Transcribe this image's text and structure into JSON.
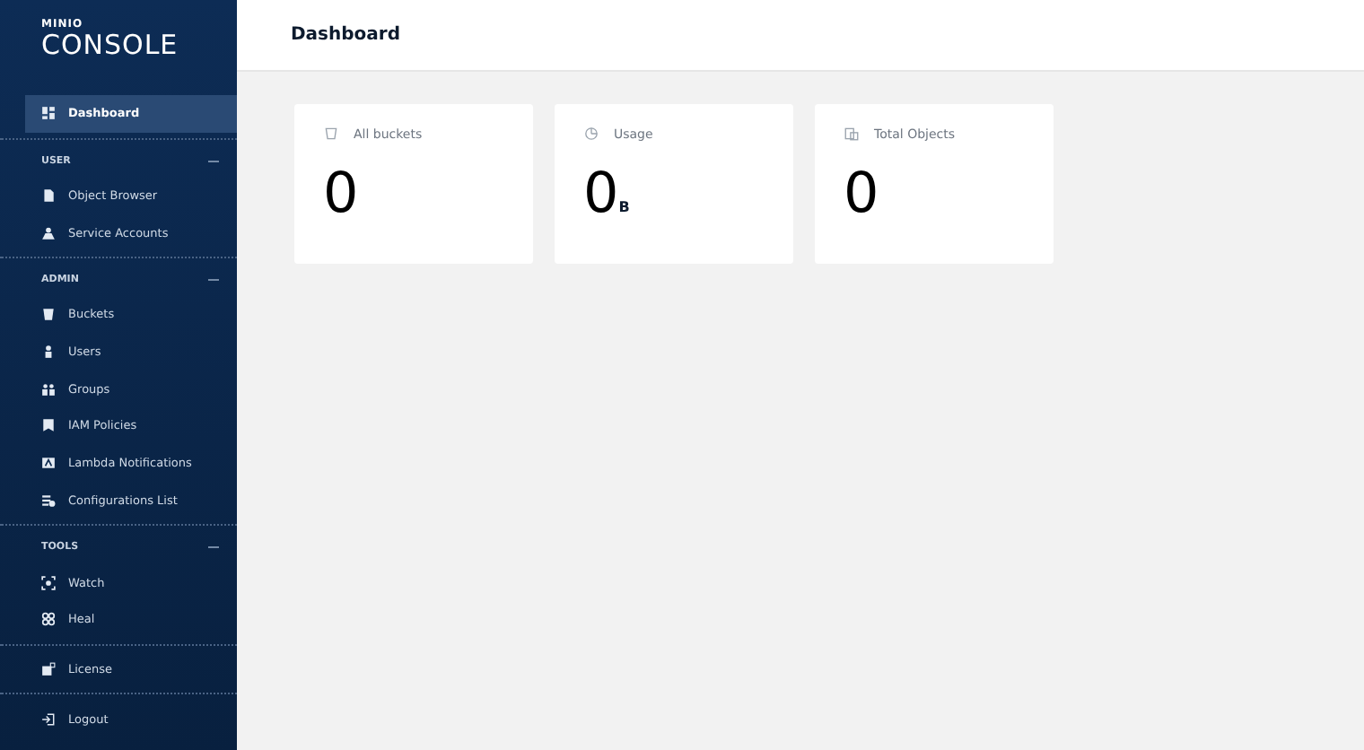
{
  "brand": {
    "top": "MINIO",
    "name": "CONSOLE"
  },
  "sidebar": {
    "sections": [
      {
        "items": [
          {
            "label": "Dashboard",
            "selected": true
          }
        ]
      },
      {
        "header": "USER",
        "expanded": true,
        "items": [
          {
            "label": "Object Browser",
            "selected": false
          },
          {
            "label": "Service Accounts",
            "selected": false
          }
        ]
      },
      {
        "header": "ADMIN",
        "expanded": true,
        "items": [
          {
            "label": "Buckets",
            "selected": false
          },
          {
            "label": "Users",
            "selected": false
          },
          {
            "label": "Groups",
            "selected": false
          },
          {
            "label": "IAM Policies",
            "selected": false
          },
          {
            "label": "Lambda Notifications",
            "selected": false
          },
          {
            "label": "Configurations List",
            "selected": false
          }
        ]
      },
      {
        "header": "TOOLS",
        "expanded": true,
        "items": [
          {
            "label": "Watch",
            "selected": false
          },
          {
            "label": "Heal",
            "selected": false
          }
        ]
      },
      {
        "items": [
          {
            "label": "License",
            "selected": false
          }
        ]
      },
      {
        "items": [
          {
            "label": "Logout",
            "selected": false
          }
        ]
      }
    ]
  },
  "page": {
    "title": "Dashboard"
  },
  "cards": [
    {
      "label": "All buckets",
      "value": "0"
    },
    {
      "label": "Usage",
      "value": "0",
      "unit": "B"
    },
    {
      "label": "Total Objects",
      "value": "0"
    }
  ]
}
